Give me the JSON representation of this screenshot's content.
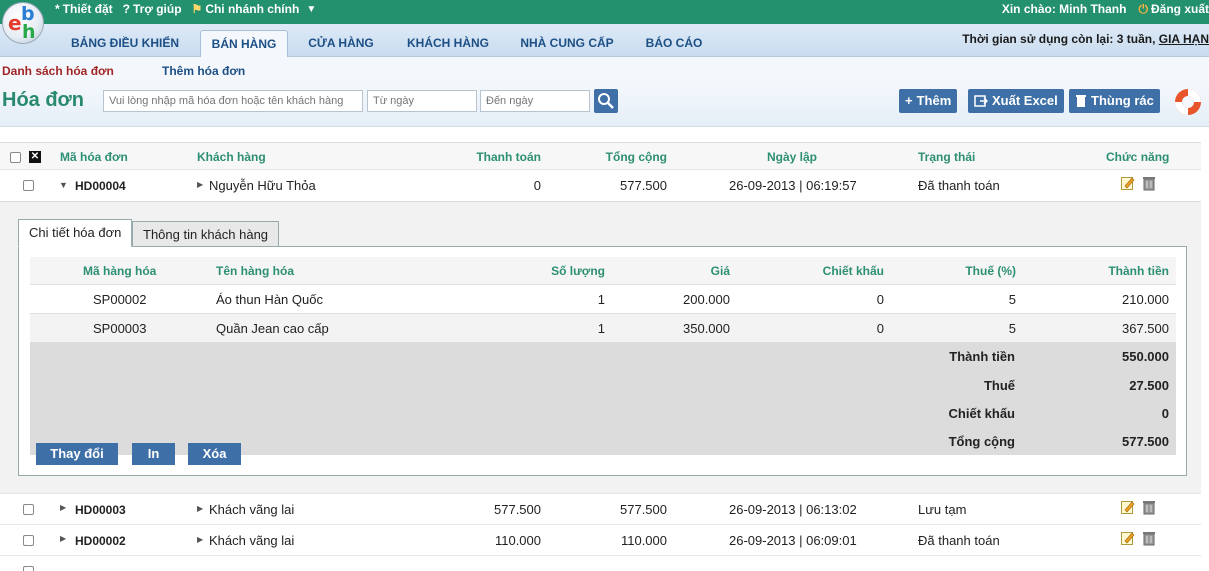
{
  "topbar": {
    "settings": "Thiết đặt",
    "help": "Trợ giúp",
    "branch": "Chi nhánh chính",
    "greeting": "Xin chào: Minh Thanh",
    "logout": "Đăng xuất"
  },
  "nav": {
    "tabs": [
      "BẢNG ĐIỀU KHIỂN",
      "BÁN HÀNG",
      "CỬA HÀNG",
      "KHÁCH HÀNG",
      "NHÀ CUNG CẤP",
      "BÁO CÁO"
    ],
    "active": "BÁN HÀNG",
    "trial_text": "Thời gian sử dụng còn lại: 3 tuần,",
    "trial_link": "GIA HẠN"
  },
  "subnav": {
    "list": "Danh sách hóa đơn",
    "add": "Thêm hóa đơn"
  },
  "toolbar": {
    "title": "Hóa đơn",
    "search_placeholder": "Vui lòng nhập mã hóa đơn hoặc tên khách hàng",
    "from_placeholder": "Từ ngày",
    "to_placeholder": "Đến ngày",
    "add_label": "Thêm",
    "excel_label": "Xuất Excel",
    "trash_label": "Thùng rác"
  },
  "table": {
    "headers": {
      "code": "Mã hóa đơn",
      "customer": "Khách hàng",
      "paid": "Thanh toán",
      "total": "Tổng cộng",
      "date": "Ngày lập",
      "status": "Trạng thái",
      "actions": "Chức năng"
    },
    "rows": [
      {
        "code": "HD00004",
        "customer": "Nguyễn Hữu Thỏa",
        "paid": "0",
        "total": "577.500",
        "date": "26-09-2013 | 06:19:57",
        "status": "Đã thanh toán"
      },
      {
        "code": "HD00003",
        "customer": "Khách vãng lai",
        "paid": "577.500",
        "total": "577.500",
        "date": "26-09-2013 | 06:13:02",
        "status": "Lưu tạm"
      },
      {
        "code": "HD00002",
        "customer": "Khách vãng lai",
        "paid": "110.000",
        "total": "110.000",
        "date": "26-09-2013 | 06:09:01",
        "status": "Đã thanh toán"
      }
    ]
  },
  "detail": {
    "tab_detail": "Chi tiết hóa đơn",
    "tab_customer": "Thông tin khách hàng",
    "headers": {
      "code": "Mã hàng hóa",
      "name": "Tên hàng hóa",
      "qty": "Số lượng",
      "price": "Giá",
      "discount": "Chiết khấu",
      "tax": "Thuế (%)",
      "amount": "Thành tiền"
    },
    "items": [
      {
        "code": "SP00002",
        "name": "Áo thun Hàn Quốc",
        "qty": "1",
        "price": "200.000",
        "discount": "0",
        "tax": "5",
        "amount": "210.000"
      },
      {
        "code": "SP00003",
        "name": "Quần Jean cao cấp",
        "qty": "1",
        "price": "350.000",
        "discount": "0",
        "tax": "5",
        "amount": "367.500"
      }
    ],
    "summary": {
      "subtotal_label": "Thành tiền",
      "subtotal": "550.000",
      "tax_label": "Thuế",
      "tax": "27.500",
      "discount_label": "Chiết khấu",
      "discount": "0",
      "total_label": "Tổng cộng",
      "total": "577.500"
    },
    "buttons": {
      "edit": "Thay đổi",
      "print": "In",
      "delete": "Xóa"
    }
  },
  "colors": {
    "brand_green": "#23906e",
    "header_text": "#2d8f73",
    "button_blue": "#3e6fa6",
    "nav_text": "#1c4f86"
  }
}
